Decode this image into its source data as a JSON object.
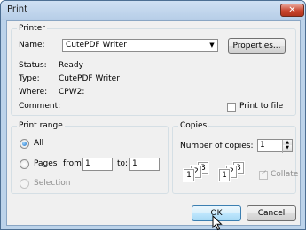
{
  "window": {
    "title": "Print",
    "close_glyph": "✕"
  },
  "printer": {
    "group_label": "Printer",
    "name_label": "Name:",
    "name_value": "CutePDF Writer",
    "properties_button": "Properties...",
    "status_label": "Status:",
    "status_value": "Ready",
    "type_label": "Type:",
    "type_value": "CutePDF Writer",
    "where_label": "Where:",
    "where_value": "CPW2:",
    "comment_label": "Comment:",
    "print_to_file_label": "Print to file",
    "print_to_file_checked": false
  },
  "print_range": {
    "group_label": "Print range",
    "all_label": "All",
    "pages_label": "Pages",
    "from_label": "from:",
    "from_value": "1",
    "to_label": "to:",
    "to_value": "1",
    "selection_label": "Selection",
    "selected": "All"
  },
  "copies": {
    "group_label": "Copies",
    "number_label": "Number of copies:",
    "number_value": "1",
    "collate_label": "Collate",
    "collate_checked": true,
    "illustration_pages": [
      "1",
      "2",
      "3",
      "1",
      "2",
      "3"
    ]
  },
  "actions": {
    "ok": "OK",
    "cancel": "Cancel"
  },
  "colors": {
    "accent": "#3c7fb1",
    "frame": "#bcd3ea",
    "close": "#c8452e"
  }
}
